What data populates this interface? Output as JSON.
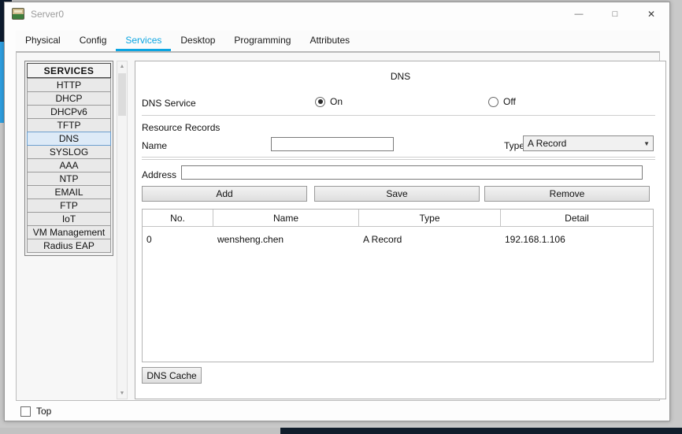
{
  "colors": {
    "accent_blue": "#0aa5e2",
    "selected_bg": "#ddeaf7",
    "selected_border": "#6c9fce"
  },
  "window": {
    "title": "Server0",
    "controls": {
      "minimize": "—",
      "maximize": "□",
      "close": "✕"
    }
  },
  "tabs": [
    {
      "label": "Physical",
      "active": false
    },
    {
      "label": "Config",
      "active": false
    },
    {
      "label": "Services",
      "active": true
    },
    {
      "label": "Desktop",
      "active": false
    },
    {
      "label": "Programming",
      "active": false
    },
    {
      "label": "Attributes",
      "active": false
    }
  ],
  "sidebar": {
    "header": "SERVICES",
    "items": [
      {
        "label": "HTTP",
        "selected": false
      },
      {
        "label": "DHCP",
        "selected": false
      },
      {
        "label": "DHCPv6",
        "selected": false
      },
      {
        "label": "TFTP",
        "selected": false
      },
      {
        "label": "DNS",
        "selected": true
      },
      {
        "label": "SYSLOG",
        "selected": false
      },
      {
        "label": "AAA",
        "selected": false
      },
      {
        "label": "NTP",
        "selected": false
      },
      {
        "label": "EMAIL",
        "selected": false
      },
      {
        "label": "FTP",
        "selected": false
      },
      {
        "label": "IoT",
        "selected": false
      },
      {
        "label": "VM Management",
        "selected": false
      },
      {
        "label": "Radius EAP",
        "selected": false
      }
    ]
  },
  "scrollbar": {
    "up": "▲",
    "down": "▼"
  },
  "panel": {
    "title": "DNS",
    "service_label": "DNS Service",
    "service_state": "On",
    "on_label": "On",
    "off_label": "Off",
    "resource_records": "Resource Records",
    "name_label": "Name",
    "name_value": "",
    "type_label": "Type",
    "type_value": "A Record",
    "combo_arrow": "▼",
    "address_label": "Address",
    "address_value": "",
    "add": "Add",
    "save": "Save",
    "remove": "Remove",
    "table": {
      "headers": [
        "No.",
        "Name",
        "Type",
        "Detail"
      ],
      "rows": [
        [
          "0",
          "wensheng.chen",
          "A Record",
          "192.168.1.106"
        ]
      ]
    },
    "dns_cache": "DNS Cache"
  },
  "footer": {
    "top_label": "Top"
  }
}
